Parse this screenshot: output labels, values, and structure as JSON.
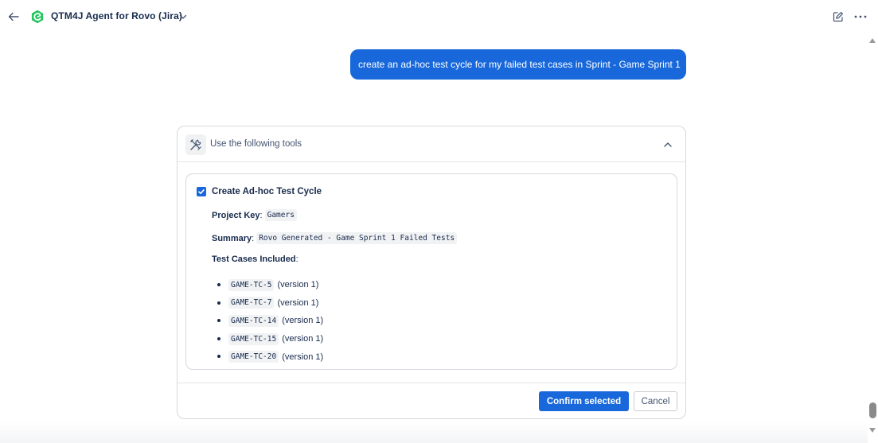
{
  "header": {
    "agent_name": "QTM4J Agent for Rovo (Jira)",
    "logo_color": "#22c55e"
  },
  "chat": {
    "user_message": "create an ad-hoc test cycle for my failed test cases in Sprint - Game Sprint 1"
  },
  "tool_card": {
    "title": "Use the following tools",
    "tool": {
      "checked": true,
      "name": "Create Ad-hoc Test Cycle",
      "project_key_label": "Project Key",
      "project_key_value": "Gamers",
      "summary_label": "Summary",
      "summary_value": "Rovo Generated - Game Sprint 1 Failed Tests",
      "test_cases_label": "Test Cases Included",
      "test_cases": [
        {
          "key": "GAME-TC-5",
          "version": "(version 1)"
        },
        {
          "key": "GAME-TC-7",
          "version": "(version 1)"
        },
        {
          "key": "GAME-TC-14",
          "version": "(version 1)"
        },
        {
          "key": "GAME-TC-15",
          "version": "(version 1)"
        },
        {
          "key": "GAME-TC-20",
          "version": "(version 1)"
        }
      ]
    },
    "confirm_label": "Confirm selected",
    "cancel_label": "Cancel"
  },
  "colors": {
    "accent": "#1868db",
    "text": "#172b4d",
    "subtle_text": "#44546f",
    "border": "#d5d9de"
  }
}
